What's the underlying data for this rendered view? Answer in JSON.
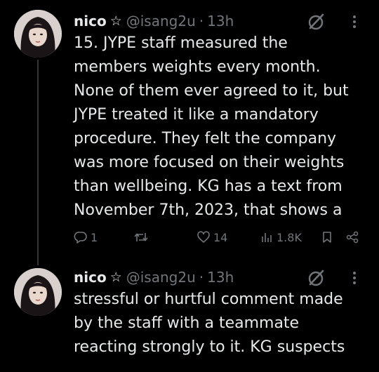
{
  "tweets": [
    {
      "author": {
        "name": "nico",
        "badge_icon": "star-outline-icon",
        "handle": "@isang2u",
        "separator": "·",
        "time": "13h"
      },
      "text": "15. JYPE staff measured the\nmembers weights every month.\nNone of them ever agreed to it, but\nJYPE treated it like a mandatory\nprocedure. They felt the company\nwas more focused on their weights\nthan wellbeing. KG has a text from\nNovember 7th, 2023, that shows a",
      "actions": {
        "replies": "1",
        "reposts": "",
        "likes": "14",
        "views": "1.8K"
      }
    },
    {
      "author": {
        "name": "nico",
        "badge_icon": "star-outline-icon",
        "handle": "@isang2u",
        "separator": "·",
        "time": "13h"
      },
      "text": "stressful or hurtful comment made\nby the staff with a teammate\nreacting strongly to it. KG suspects"
    }
  ],
  "colors": {
    "background": "#000000",
    "primary_text": "#e7e9ea",
    "secondary_text": "#71767b",
    "thread_line": "#333639"
  }
}
